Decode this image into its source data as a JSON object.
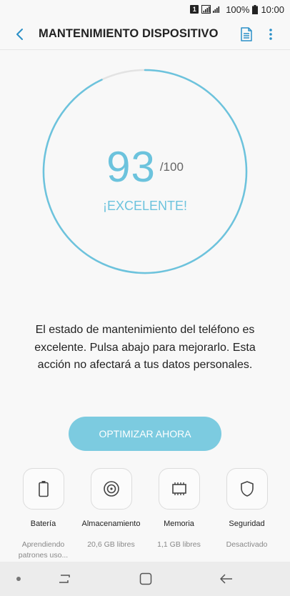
{
  "status_bar": {
    "sim": "1",
    "battery_percent": "100%",
    "time": "10:00"
  },
  "app_bar": {
    "title": "MANTENIMIENTO DISPOSITIVO",
    "icons": [
      "back-arrow-icon",
      "report-icon",
      "more-vert-icon"
    ]
  },
  "gauge": {
    "score": "93",
    "max": "/100",
    "fraction": 0.93,
    "rating": "¡EXCELENTE!",
    "accent_color": "#6cc3dd",
    "track_color": "#e3e3e3"
  },
  "description": "El estado de mantenimiento del teléfono es excelente. Pulsa abajo para mejorarlo. Esta acción no afectará a tus datos personales.",
  "optimize_button": {
    "label": "OPTIMIZAR AHORA",
    "color": "#7ccbe0"
  },
  "tiles": [
    {
      "icon": "battery-icon",
      "label": "Batería",
      "status": "Aprendiendo patrones uso..."
    },
    {
      "icon": "storage-icon",
      "label": "Almacenamiento",
      "status": "20,6 GB libres"
    },
    {
      "icon": "memory-chip-icon",
      "label": "Memoria",
      "status": "1,1 GB libres"
    },
    {
      "icon": "shield-icon",
      "label": "Seguridad",
      "status": "Desactivado"
    }
  ],
  "nav_bar": {
    "icons": [
      "recent-apps-icon",
      "home-icon",
      "back-icon"
    ]
  }
}
